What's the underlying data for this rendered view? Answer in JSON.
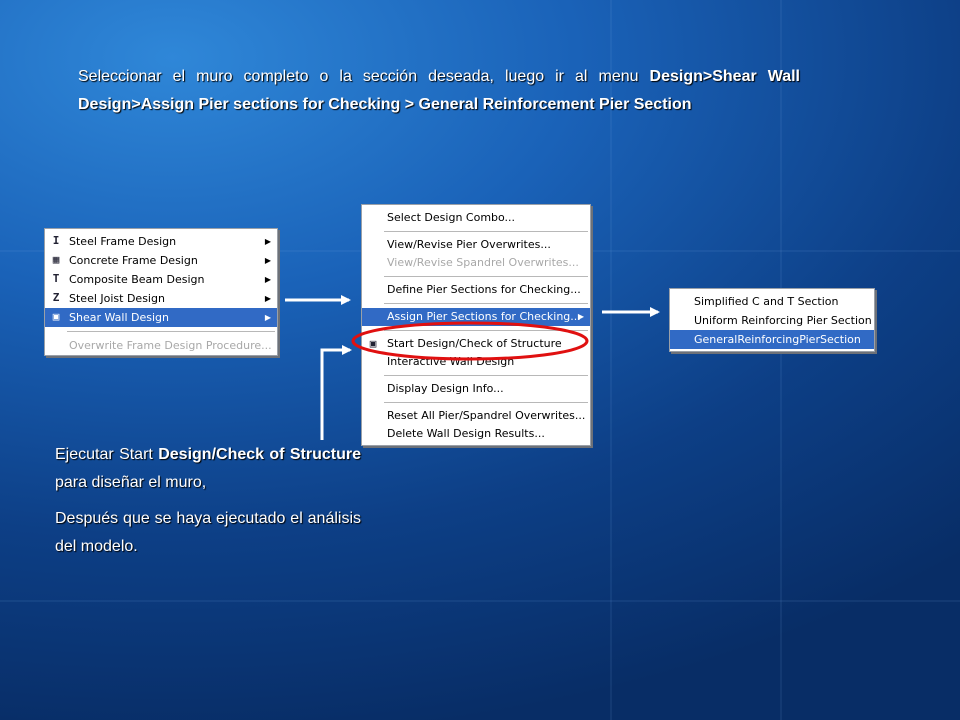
{
  "intro": {
    "text": "Seleccionar el muro completo o la sección deseada, luego ir al menu ",
    "bold": "Design>Shear Wall Design>Assign Pier sections for Checking > General Reinforcement Pier Section"
  },
  "menu1": {
    "items": [
      {
        "label": "Steel Frame Design",
        "icon": "steel-frame-icon",
        "glyph": "I"
      },
      {
        "label": "Concrete Frame Design",
        "icon": "concrete-frame-icon",
        "glyph": "▦"
      },
      {
        "label": "Composite Beam Design",
        "icon": "composite-beam-icon",
        "glyph": "T"
      },
      {
        "label": "Steel Joist Design",
        "icon": "steel-joist-icon",
        "glyph": "Z"
      },
      {
        "label": "Shear Wall Design",
        "icon": "shear-wall-icon",
        "glyph": "▣"
      },
      {
        "label": "Overwrite Frame Design Procedure..."
      }
    ]
  },
  "menu2": {
    "items": [
      {
        "label": "Select Design Combo..."
      },
      {
        "label": "View/Revise Pier Overwrites..."
      },
      {
        "label": "View/Revise Spandrel Overwrites..."
      },
      {
        "label": "Define Pier Sections for Checking..."
      },
      {
        "label": "Assign Pier Sections for Checking..."
      },
      {
        "label": "Start Design/Check of Structure",
        "icon": "start-design-icon",
        "glyph": "▣"
      },
      {
        "label": "Interactive Wall Design"
      },
      {
        "label": "Display Design Info..."
      },
      {
        "label": "Reset All Pier/Spandrel Overwrites..."
      },
      {
        "label": "Delete Wall Design Results..."
      }
    ]
  },
  "menu3": {
    "items": [
      {
        "label": "Simplified C and T Section"
      },
      {
        "label": "Uniform Reinforcing Pier Section"
      },
      {
        "label": "GeneralReinforcingPierSection"
      }
    ]
  },
  "note1": {
    "a": "Ejecutar Start ",
    "b": "Design/Check of Structure",
    "c": " para diseñar el muro,"
  },
  "note2": {
    "text": "Después que se haya ejecutado el análisis del modelo."
  },
  "colors": {
    "highlight": "#316ac5",
    "circle": "#e01010",
    "arrow": "#ffffff"
  }
}
